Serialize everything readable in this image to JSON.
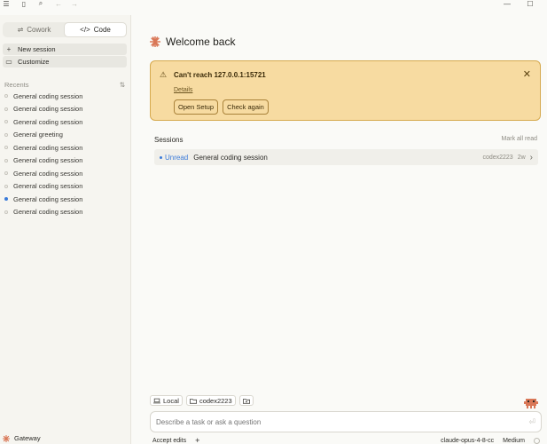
{
  "titlebar": {
    "menu_icon": "☰",
    "sidebar_icon": "▯",
    "search_icon": "⌕",
    "back_icon": "←",
    "forward_icon": "→",
    "minimize": "—",
    "maximize": "☐"
  },
  "sidebar": {
    "modes": [
      {
        "label": "Cowork",
        "icon": "⇌",
        "active": false
      },
      {
        "label": "Code",
        "icon": "</>",
        "active": true
      }
    ],
    "nav": [
      {
        "label": "New session",
        "icon": "+"
      },
      {
        "label": "Customize",
        "icon": "▭"
      }
    ],
    "recents_label": "Recents",
    "filter_icon": "⇅",
    "recents": [
      {
        "label": "General coding session",
        "unread": false
      },
      {
        "label": "General coding session",
        "unread": false
      },
      {
        "label": "General coding session",
        "unread": false
      },
      {
        "label": "General greeting",
        "unread": false
      },
      {
        "label": "General coding session",
        "unread": false
      },
      {
        "label": "General coding session",
        "unread": false
      },
      {
        "label": "General coding session",
        "unread": false
      },
      {
        "label": "General coding session",
        "unread": false
      },
      {
        "label": "General coding session",
        "unread": true
      },
      {
        "label": "General coding session",
        "unread": false
      }
    ],
    "footer_label": "Gateway"
  },
  "main": {
    "welcome": "Welcome back",
    "alert": {
      "title": "Can't reach 127.0.0.1:15721",
      "details": "Details",
      "open_setup": "Open Setup",
      "check_again": "Check again",
      "close": "✕",
      "warn": "⚠"
    },
    "sessions": {
      "heading": "Sessions",
      "mark_all": "Mark all read",
      "rows": [
        {
          "status": "Unread",
          "title": "General coding session",
          "user": "codex2223",
          "age": "2w",
          "chevron": "›"
        }
      ]
    },
    "composer": {
      "chip_local": "Local",
      "chip_folder": "codex2223",
      "placeholder": "Describe a task or ask a question",
      "accept_edits": "Accept edits",
      "add": "+",
      "model": "claude-opus-4-8-cc",
      "effort": "Medium",
      "send": "⏎"
    }
  },
  "colors": {
    "accent": "#d97757",
    "alert_bg": "#f7dba1",
    "alert_border": "#d6aa4f",
    "unread_blue": "#3b7bd9"
  }
}
